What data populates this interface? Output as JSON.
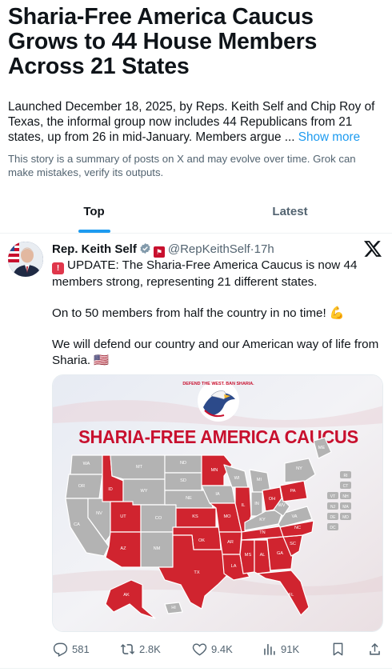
{
  "headline": "Sharia-Free America Caucus Grows to 44 House Members Across 21 States",
  "summary": {
    "text": "Launched December 18, 2025, by Reps. Keith Self and Chip Roy of Texas, the informal group now includes 44 Republicans from 21 states, up from 26 in mid-January. Members argue ...",
    "show_more": "Show more"
  },
  "disclaimer": "This story is a summary of posts on X and may evolve over time. Grok can make mistakes, verify its outputs.",
  "tabs": [
    {
      "label": "Top",
      "active": true
    },
    {
      "label": "Latest",
      "active": false
    }
  ],
  "post": {
    "author_name": "Rep. Keith Self",
    "handle": "@RepKeithSelf",
    "time": "17h",
    "paragraphs": [
      "UPDATE: The Sharia-Free America Caucus is now 44 members strong, representing 21 different states.",
      "On to 50 members from half the country in no time! 💪",
      "We will defend our country and our American way of life from Sharia. 🇺🇸"
    ],
    "image": {
      "logo_arc_text": "DEFEND THE WEST. BAN SHARIA.",
      "title": "SHARIA-FREE AMERICA CAUCUS",
      "member_states": [
        "ID",
        "UT",
        "AZ",
        "MN",
        "KS",
        "OK",
        "TX",
        "MO",
        "IL",
        "AR",
        "LA",
        "MS",
        "AL",
        "GA",
        "FL",
        "SC",
        "NC",
        "TN",
        "OH",
        "PA",
        "AK"
      ],
      "state_labels": {
        "WA": "WA",
        "OR": "OR",
        "CA": "CA",
        "NV": "NV",
        "ID": "ID",
        "MT": "MT",
        "WY": "WY",
        "UT": "UT",
        "AZ": "AZ",
        "CO": "CO",
        "NM": "NM",
        "ND": "ND",
        "SD": "SD",
        "NE": "NE",
        "KS": "KS",
        "OK": "OK",
        "TX": "TX",
        "MN": "MN",
        "IA": "IA",
        "MO": "MO",
        "AR": "AR",
        "LA": "LA",
        "WI": "WI",
        "IL": "IL",
        "MI": "MI",
        "IN": "IN",
        "OH": "OH",
        "KY": "KY",
        "TN": "TN",
        "MS": "MS",
        "AL": "AL",
        "GA": "GA",
        "FL": "FL",
        "SC": "SC",
        "NC": "NC",
        "VA": "VA",
        "WV": "WV",
        "PA": "PA",
        "NY": "NY",
        "ME": "ME",
        "AK": "AK",
        "HI": "HI"
      },
      "small_states": [
        "RI",
        "CT",
        "VT",
        "NH",
        "NJ",
        "MA",
        "DE",
        "MD",
        "DC"
      ]
    },
    "stats": {
      "replies": "581",
      "reposts": "2.8K",
      "likes": "9.4K",
      "views": "91K"
    }
  },
  "colors": {
    "accent": "#1d9bf0",
    "member_red": "#d0242f",
    "nonmember_gray": "#b3b3b3",
    "text_secondary": "#536471"
  }
}
